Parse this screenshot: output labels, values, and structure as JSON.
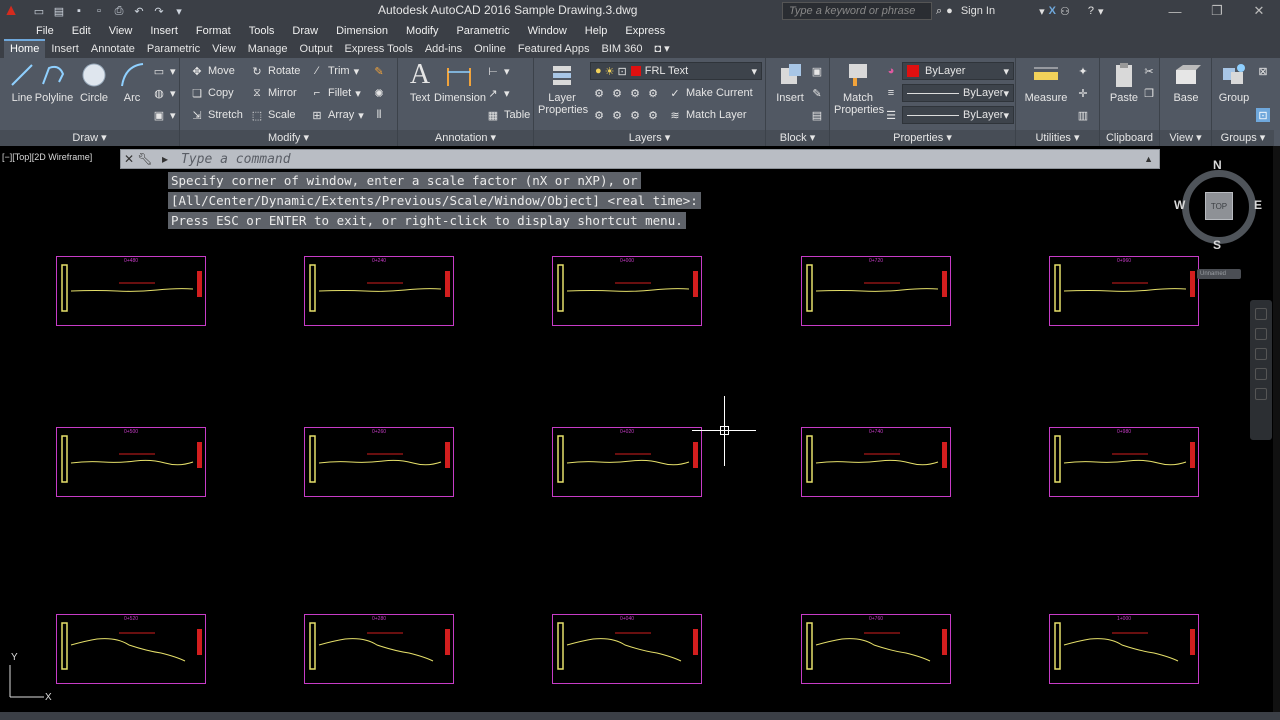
{
  "title_bar": {
    "title": "Autodesk AutoCAD 2016    Sample Drawing.3.dwg",
    "search_placeholder": "Type a keyword or phrase",
    "sign_in": "Sign In"
  },
  "menu": [
    "File",
    "Edit",
    "View",
    "Insert",
    "Format",
    "Tools",
    "Draw",
    "Dimension",
    "Modify",
    "Parametric",
    "Window",
    "Help",
    "Express"
  ],
  "ribbon_tabs": [
    "Home",
    "Insert",
    "Annotate",
    "Parametric",
    "View",
    "Manage",
    "Output",
    "Express Tools",
    "Add-ins",
    "Online",
    "Featured Apps",
    "BIM 360"
  ],
  "ribbon": {
    "draw": {
      "footer": "Draw ▾",
      "line": "Line",
      "polyline": "Polyline",
      "circle": "Circle",
      "arc": "Arc"
    },
    "modify": {
      "footer": "Modify ▾",
      "move": "Move",
      "rotate": "Rotate",
      "trim": "Trim",
      "copy": "Copy",
      "mirror": "Mirror",
      "fillet": "Fillet",
      "stretch": "Stretch",
      "scale": "Scale",
      "array": "Array"
    },
    "annotation": {
      "footer": "Annotation ▾",
      "text": "Text",
      "dimension": "Dimension",
      "table": "Table"
    },
    "layers": {
      "footer": "Layers ▾",
      "layer_properties": "Layer\nProperties",
      "current_layer": "FRL Text",
      "make_current": "Make Current",
      "match_layer": "Match Layer"
    },
    "block": {
      "footer": "Block ▾",
      "insert": "Insert"
    },
    "properties": {
      "footer": "Properties ▾",
      "match_properties": "Match\nProperties",
      "color": "ByLayer",
      "linetype": "ByLayer",
      "lineweight": "ByLayer"
    },
    "utilities": {
      "footer": "Utilities ▾",
      "measure": "Measure"
    },
    "clipboard": {
      "footer": "Clipboard",
      "paste": "Paste"
    },
    "view": {
      "footer": "View ▾",
      "base": "Base"
    },
    "groups": {
      "footer": "Groups ▾",
      "group": "Group"
    }
  },
  "viewport_label": "[−][Top][2D Wireframe]",
  "command": {
    "placeholder": "Type a command",
    "history": [
      "Specify corner of window, enter a scale factor (nX or nXP), or",
      "[All/Center/Dynamic/Extents/Previous/Scale/Window/Object] <real time>:",
      "Press ESC or ENTER to exit, or right-click to display shortcut menu."
    ]
  },
  "viewcube": {
    "north": "N",
    "south": "S",
    "east": "E",
    "west": "W",
    "face": "TOP",
    "ucs": "Unnamed"
  },
  "ucs": {
    "x": "X",
    "y": "Y"
  },
  "sheets": [
    {
      "label": "0+480",
      "profile": "flat"
    },
    {
      "label": "0+240",
      "profile": "flat"
    },
    {
      "label": "0+000",
      "profile": "flat"
    },
    {
      "label": "0+720",
      "profile": "flat"
    },
    {
      "label": "0+960",
      "profile": "flat"
    },
    {
      "label": "0+500",
      "profile": "wave"
    },
    {
      "label": "0+260",
      "profile": "wave"
    },
    {
      "label": "0+020",
      "profile": "wave"
    },
    {
      "label": "0+740",
      "profile": "wave"
    },
    {
      "label": "0+980",
      "profile": "wave"
    },
    {
      "label": "0+520",
      "profile": "slope"
    },
    {
      "label": "0+280",
      "profile": "slope"
    },
    {
      "label": "0+040",
      "profile": "slope"
    },
    {
      "label": "0+760",
      "profile": "slope"
    },
    {
      "label": "1+000",
      "profile": "slope"
    }
  ],
  "colors": {
    "accent": "#6fa8dc",
    "sheet_border": "#c73cc7",
    "profile_line": "#e6e06a",
    "red_mark": "#d21e1e",
    "layer_red": "#e01010"
  }
}
